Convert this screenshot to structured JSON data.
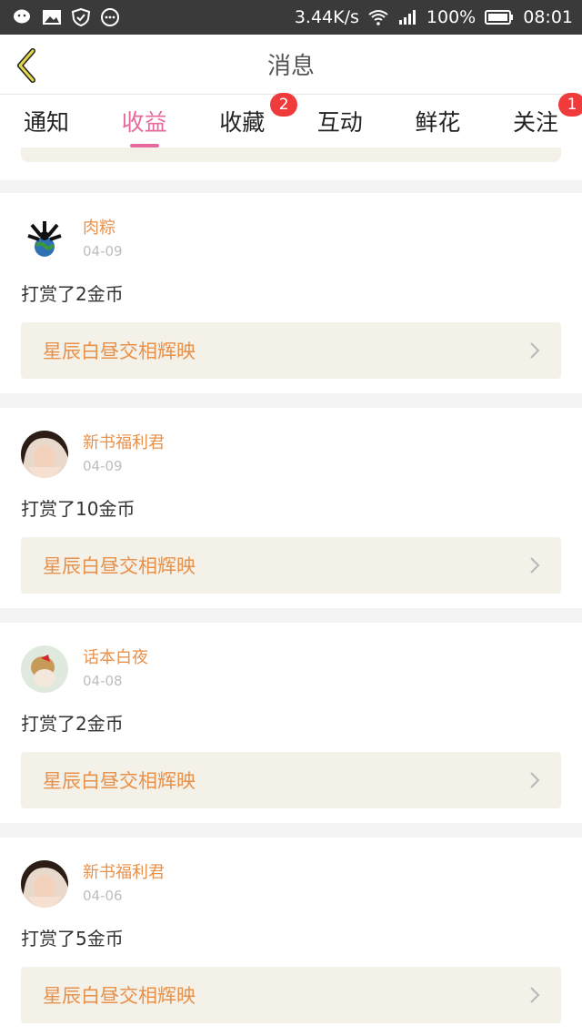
{
  "status": {
    "speed": "3.44K/s",
    "battery": "100%",
    "time": "08:01"
  },
  "header": {
    "title": "消息"
  },
  "tabs": [
    {
      "label": "通知"
    },
    {
      "label": "收益"
    },
    {
      "label": "收藏",
      "badge": "2"
    },
    {
      "label": "互动"
    },
    {
      "label": "鲜花"
    },
    {
      "label": "关注",
      "badge": "1"
    }
  ],
  "messages": [
    {
      "user": "肉粽",
      "date": "04-09",
      "action": "打赏了2金币",
      "book": "星辰白昼交相辉映"
    },
    {
      "user": "新书福利君",
      "date": "04-09",
      "action": "打赏了10金币",
      "book": "星辰白昼交相辉映"
    },
    {
      "user": "话本白夜",
      "date": "04-08",
      "action": "打赏了2金币",
      "book": "星辰白昼交相辉映"
    },
    {
      "user": "新书福利君",
      "date": "04-06",
      "action": "打赏了5金币",
      "book": "星辰白昼交相辉映"
    }
  ],
  "colors": {
    "accent": "#e66a9d",
    "name": "#e8914b",
    "badge": "#ef3b3b"
  },
  "icons": [
    "wechat-icon",
    "gallery-icon",
    "shield-icon",
    "more-icon",
    "wifi-icon",
    "signal-icon",
    "battery-icon",
    "back-arrow-icon",
    "chevron-right-icon"
  ]
}
